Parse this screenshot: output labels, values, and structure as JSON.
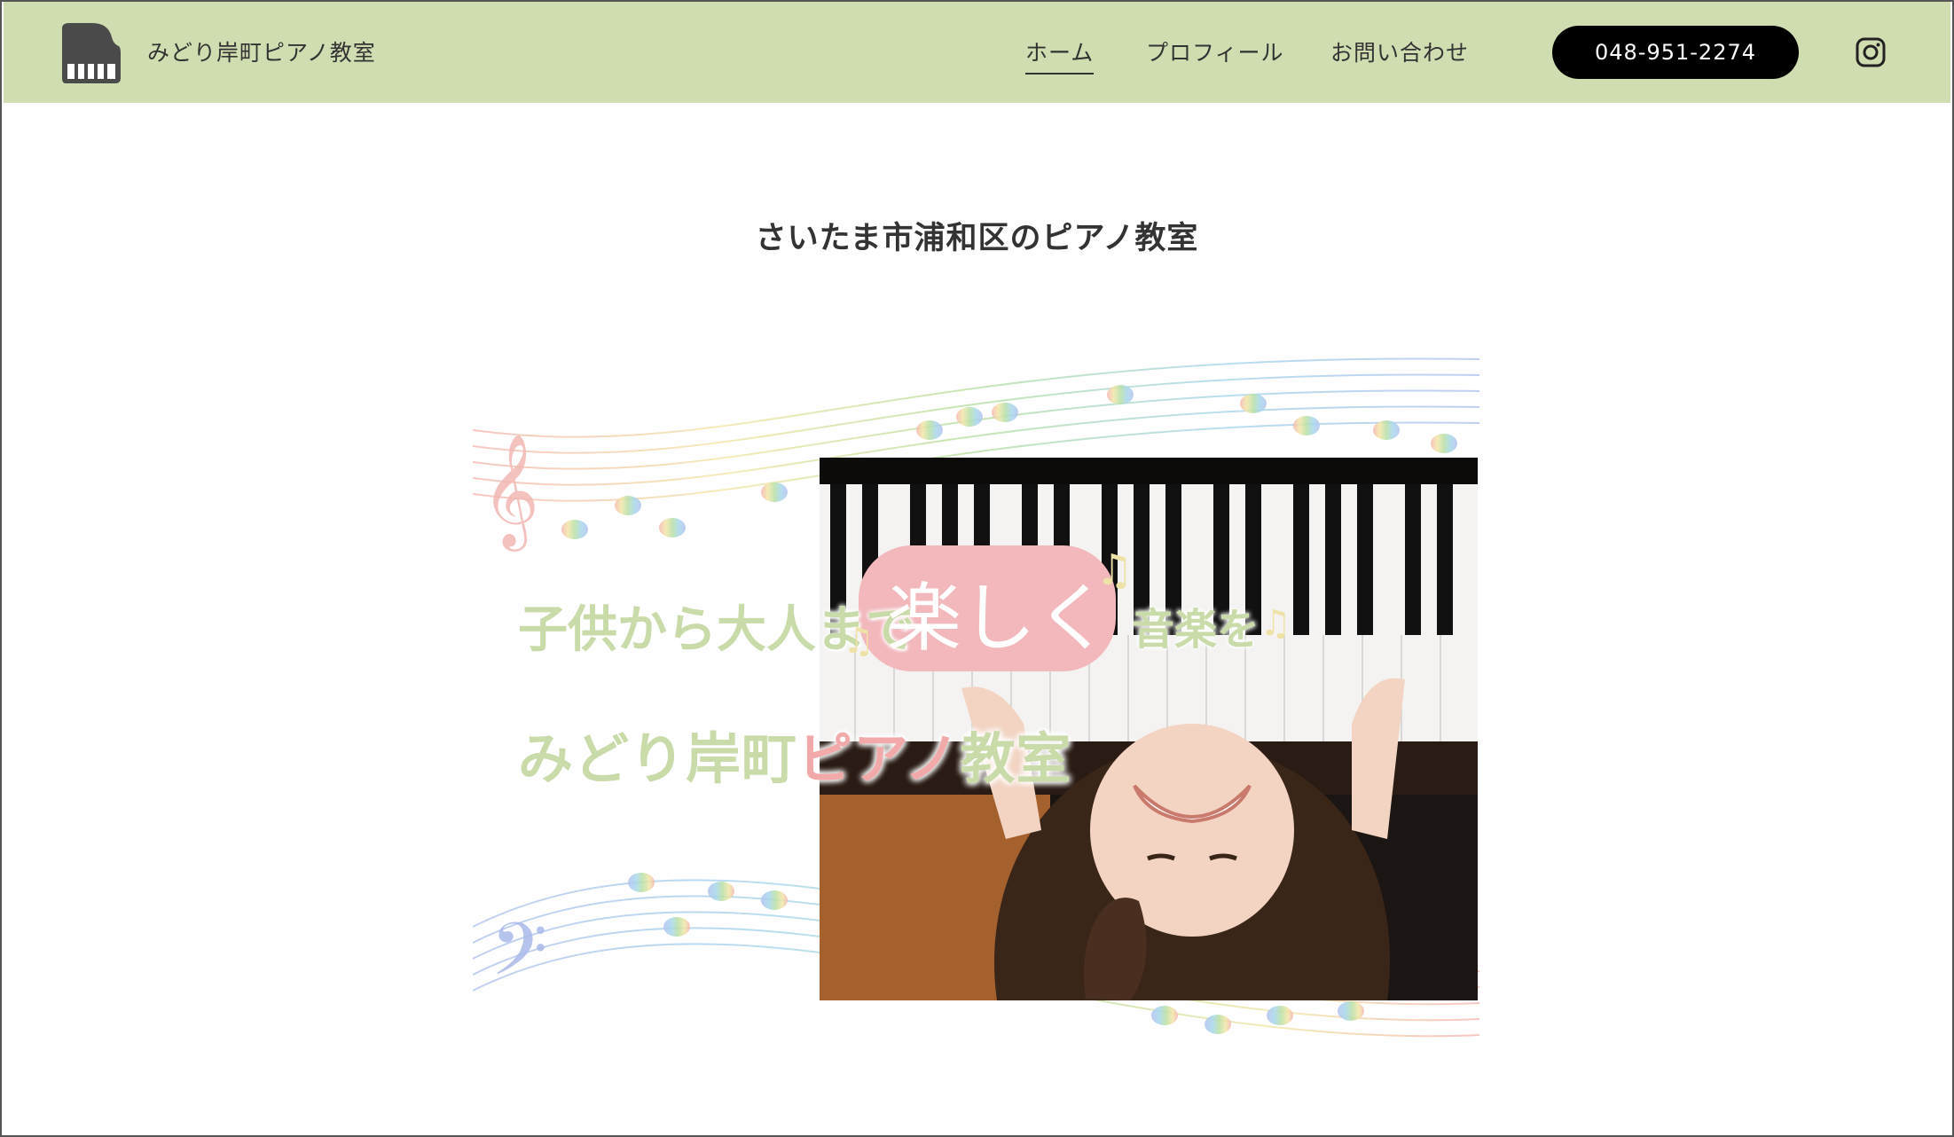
{
  "header": {
    "site_name": "みどり岸町ピアノ教室",
    "nav": [
      {
        "label": "ホーム",
        "active": true
      },
      {
        "label": "プロフィール",
        "active": false
      },
      {
        "label": "お問い合わせ",
        "active": false
      }
    ],
    "phone": "048-951-2274",
    "logo_icon": "piano-icon",
    "social_icon": "instagram-icon",
    "bg_color": "#cfddb0"
  },
  "main": {
    "headline": "さいたま市浦和区のピアノ教室",
    "hero": {
      "tagline_a": "子供から大人まで",
      "tagline_b": "楽しく",
      "tagline_c": "音楽を",
      "title_green_1": "みどり岸町",
      "title_pink": "ピアノ",
      "title_green_2": "教室"
    }
  }
}
